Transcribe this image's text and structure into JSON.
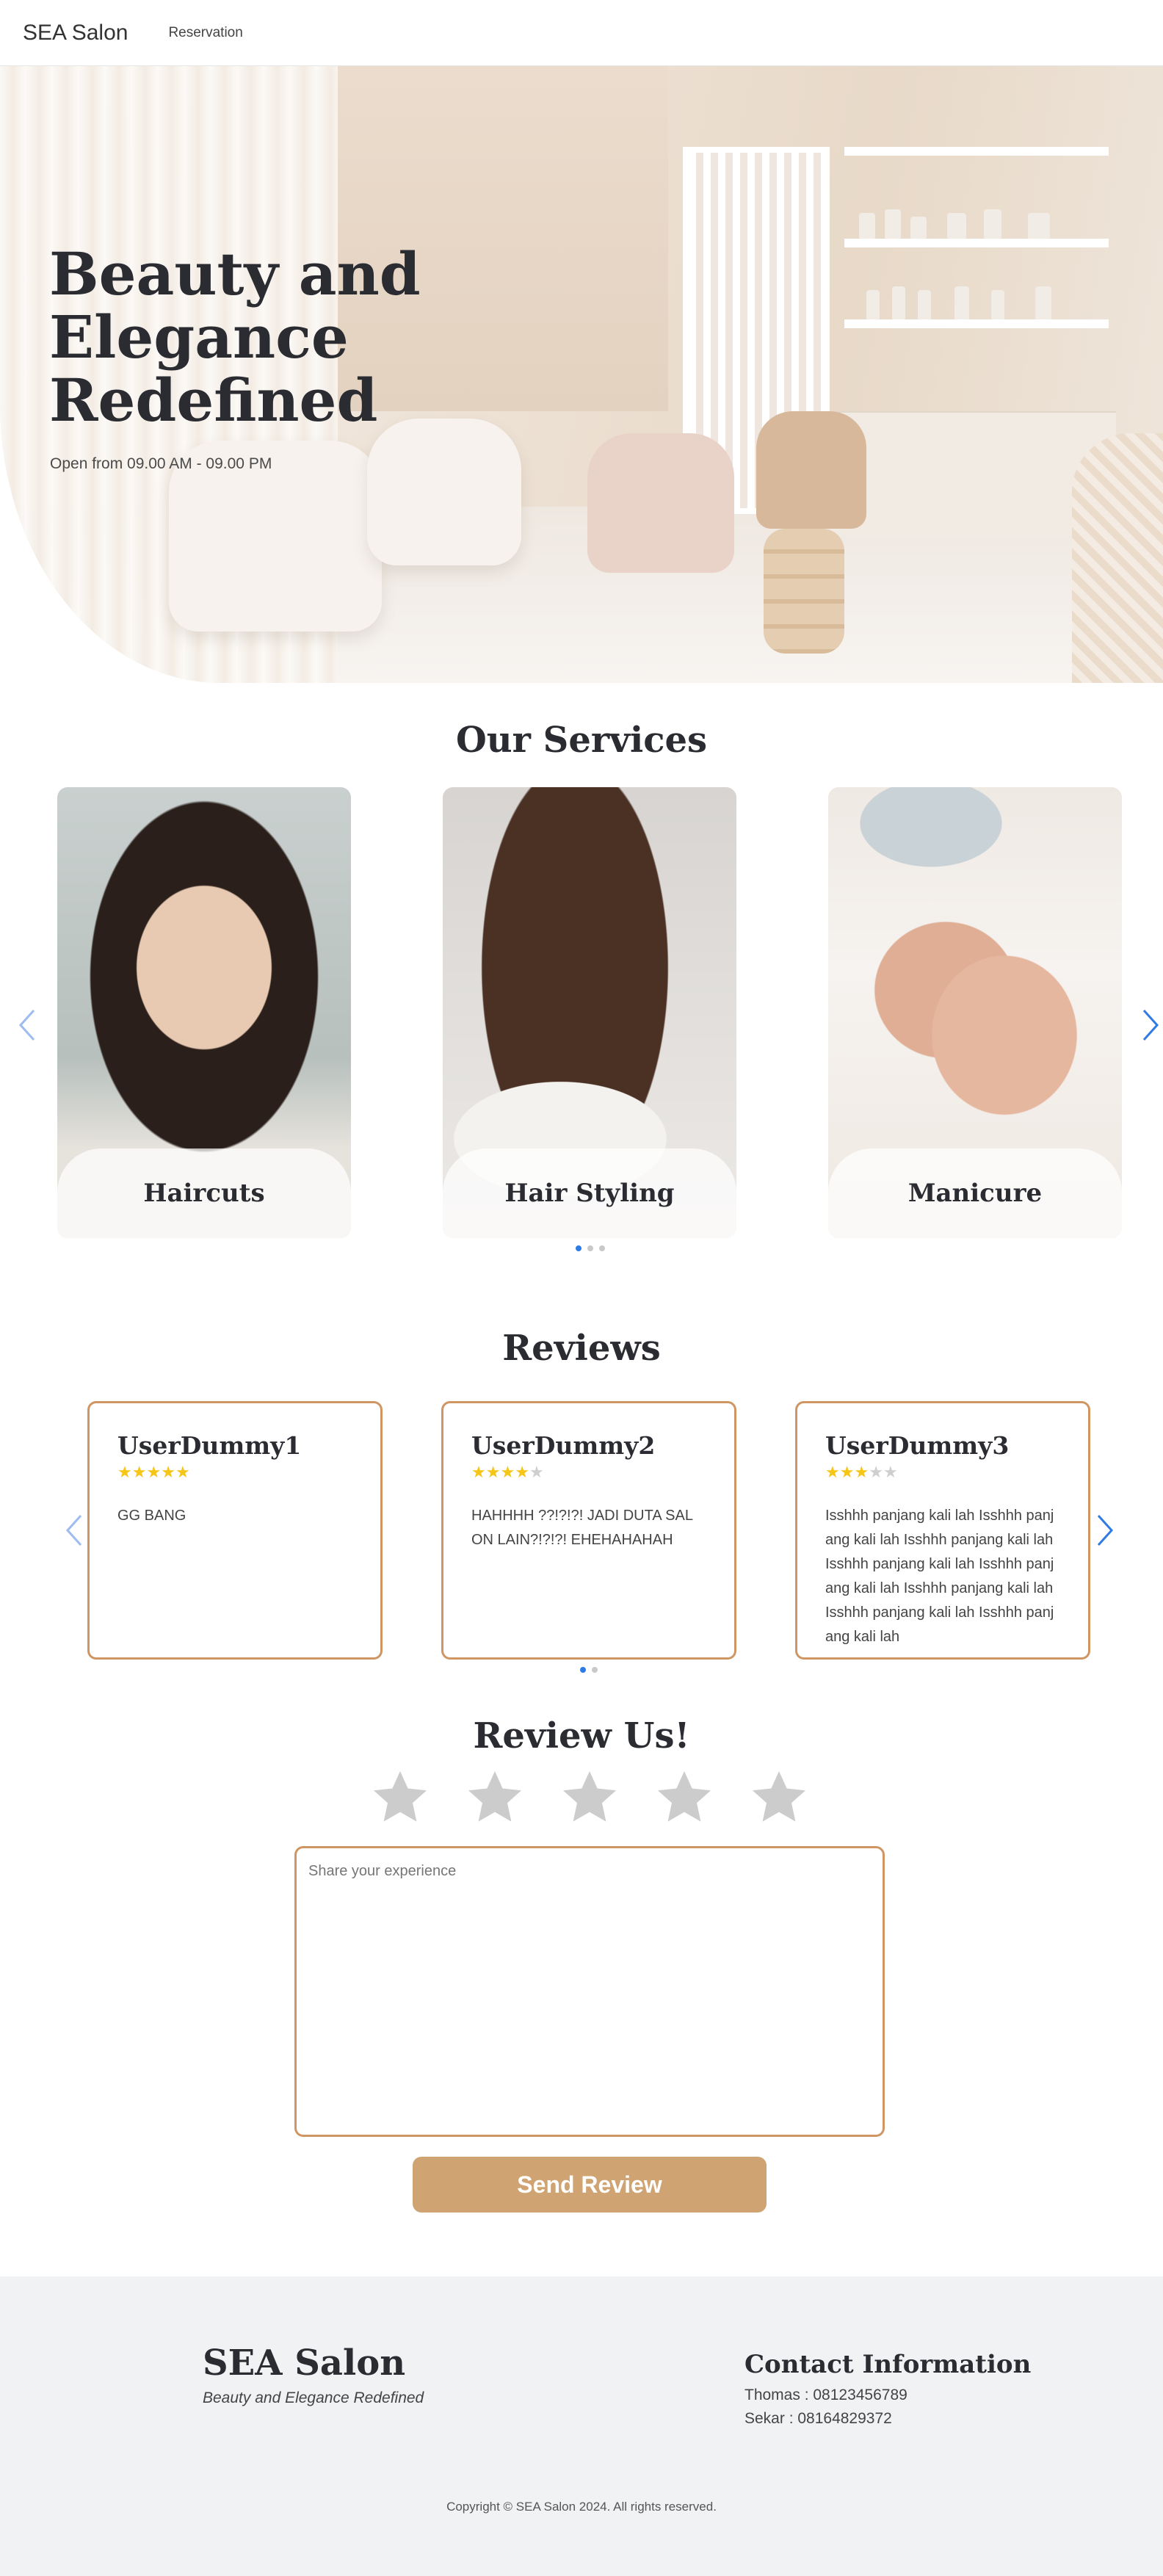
{
  "nav": {
    "brand": "SEA Salon",
    "links": [
      "Reservation"
    ]
  },
  "hero": {
    "title": "Beauty and Elegance Redefined",
    "subtitle": "Open from 09.00 AM - 09.00 PM"
  },
  "services": {
    "title": "Our Services",
    "items": [
      {
        "label": "Haircuts"
      },
      {
        "label": "Hair Styling"
      },
      {
        "label": "Manicure"
      }
    ],
    "pagination": {
      "pages": 3,
      "active": 1
    }
  },
  "reviews": {
    "title": "Reviews",
    "items": [
      {
        "name": "UserDummy1",
        "rating": 5,
        "text": "GG BANG"
      },
      {
        "name": "UserDummy2",
        "rating": 4,
        "text": "HAHHHH ??!?!?! JADI DUTA SAL ON LAIN?!?!?! EHEHAHAHAH"
      },
      {
        "name": "UserDummy3",
        "rating": 3,
        "text": "Isshhh panjang kali lah Isshhh panjang kali lah Isshhh panjang kali lah Isshhh panjang kali lah Isshhh panjang kali lah Isshhh panjang kali lah Isshhh panjang kali lah Isshhh panjang kali lah"
      }
    ],
    "pagination": {
      "pages": 2,
      "active": 1
    },
    "max_rating": 5
  },
  "review_form": {
    "title": "Review Us!",
    "stars": 5,
    "selected": 0,
    "placeholder": "Share your experience",
    "submit_label": "Send Review"
  },
  "footer": {
    "brand": "SEA Salon",
    "tagline": "Beauty and Elegance Redefined",
    "contact_title": "Contact Information",
    "contacts": [
      "Thomas : 08123456789",
      "Sekar : 08164829372"
    ],
    "copyright": "Copyright © SEA Salon 2024. All rights reserved."
  },
  "colors": {
    "accent": "#cf9562",
    "button": "#cfa472",
    "star": "#f5c518",
    "dot_active": "#2f7be6",
    "footer_bg": "#f1f2f4"
  }
}
